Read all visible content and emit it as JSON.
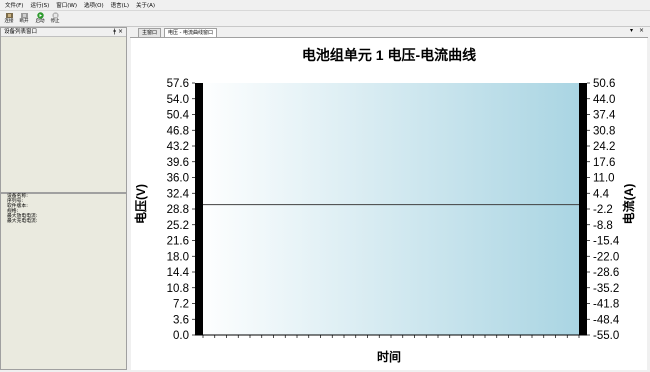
{
  "menu": [
    "文件(F)",
    "运行(S)",
    "窗口(W)",
    "选项(O)",
    "语言(L)",
    "关于(A)"
  ],
  "toolbar": [
    {
      "label": "连接",
      "icon": "connect-icon"
    },
    {
      "label": "断开",
      "icon": "disconnect-icon"
    },
    {
      "label": "启动",
      "icon": "start-icon"
    },
    {
      "label": "停止",
      "icon": "stop-icon"
    }
  ],
  "device_panel": {
    "title": "设备列表窗口",
    "pin": "ǂ",
    "close": "×"
  },
  "properties": [
    "设备名称:",
    "序列号:",
    "软件版本:",
    "规格:",
    "最大放电电流:",
    "最大充电电流:"
  ],
  "tabs": [
    {
      "label": "主窗口",
      "active": false
    },
    {
      "label": "电压 - 电流曲线窗口",
      "active": true
    }
  ],
  "tab_controls": {
    "dropdown": "▾",
    "close": "×"
  },
  "chart_data": {
    "type": "line",
    "title": "电池组单元 1 电压-电流曲线",
    "xlabel": "时间",
    "ylabel_left": "电压(V)",
    "ylabel_right": "电流(A)",
    "left_ticks": [
      "57.6",
      "54.0",
      "50.4",
      "46.8",
      "43.2",
      "39.6",
      "36.0",
      "32.4",
      "28.8",
      "25.2",
      "21.6",
      "18.0",
      "14.4",
      "10.8",
      "7.2",
      "3.6",
      "0.0"
    ],
    "right_ticks": [
      "50.6",
      "44.0",
      "37.4",
      "30.8",
      "24.2",
      "17.6",
      "11.0",
      "4.4",
      "-2.2",
      "-8.8",
      "-15.4",
      "-22.0",
      "-28.6",
      "-35.2",
      "-41.8",
      "-48.4",
      "-55.0"
    ],
    "ylim_left": [
      0,
      57.6
    ],
    "ylim_right": [
      -55.0,
      50.6
    ],
    "series": [
      {
        "axis": "left",
        "y": 29.8,
        "color": "#404040"
      }
    ],
    "colors": {
      "plot_gradient_start": "#ffffff",
      "plot_gradient_end": "#a8d4e2",
      "border": "#000000"
    }
  }
}
